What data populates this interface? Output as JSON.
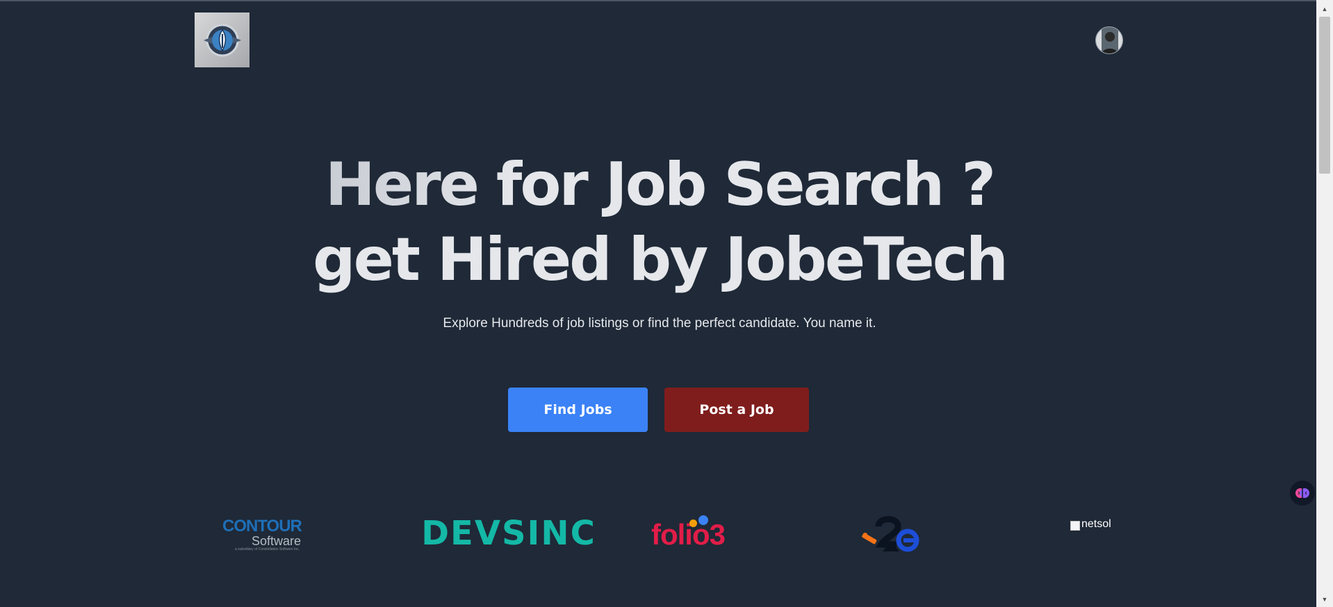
{
  "header": {
    "logo_icon": "shield-emblem-logo",
    "avatar_icon": "user-avatar"
  },
  "hero": {
    "title_line1": "Here for Job Search ?",
    "title_line2": "get Hired by JobeTech",
    "subtitle": "Explore Hundreds of job listings or find the perfect candidate. You name it."
  },
  "actions": {
    "find_jobs_label": "Find Jobs",
    "post_job_label": "Post a Job"
  },
  "companies": {
    "contour": {
      "name": "CONTOUR",
      "sub": "Software",
      "tagline": "a subsidiary of Constellation Software Inc."
    },
    "devsinc": {
      "name": "DEVSINC"
    },
    "folio3": {
      "name": "folio3"
    },
    "i2c": {
      "icon": "i2c-logo"
    },
    "netsol": {
      "alt": "netsol"
    }
  },
  "colors": {
    "background": "#1f2937",
    "primary_button": "#3b82f6",
    "secondary_button": "#7f1d1d",
    "text": "#e5e7eb"
  }
}
